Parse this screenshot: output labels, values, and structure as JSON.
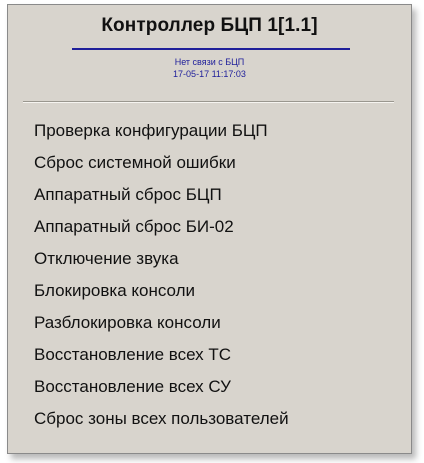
{
  "header": {
    "title": "Контроллер БЦП 1[1.1]",
    "status": "Нет связи с БЦП",
    "timestamp": "17-05-17 11:17:03"
  },
  "menu": {
    "items": [
      {
        "label": "Проверка конфигурации БЦП"
      },
      {
        "label": "Сброс системной ошибки"
      },
      {
        "label": "Аппаратный сброс БЦП"
      },
      {
        "label": "Аппаратный сброс БИ-02"
      },
      {
        "label": "Отключение звука"
      },
      {
        "label": "Блокировка консоли"
      },
      {
        "label": "Разблокировка консоли"
      },
      {
        "label": "Восстановление всех ТС"
      },
      {
        "label": "Восстановление всех СУ"
      },
      {
        "label": "Сброс зоны всех пользователей"
      }
    ]
  },
  "colors": {
    "menu_background": "#d8d4cd",
    "title_rule": "#1f1f9a",
    "status_text": "#1e1e9a"
  }
}
